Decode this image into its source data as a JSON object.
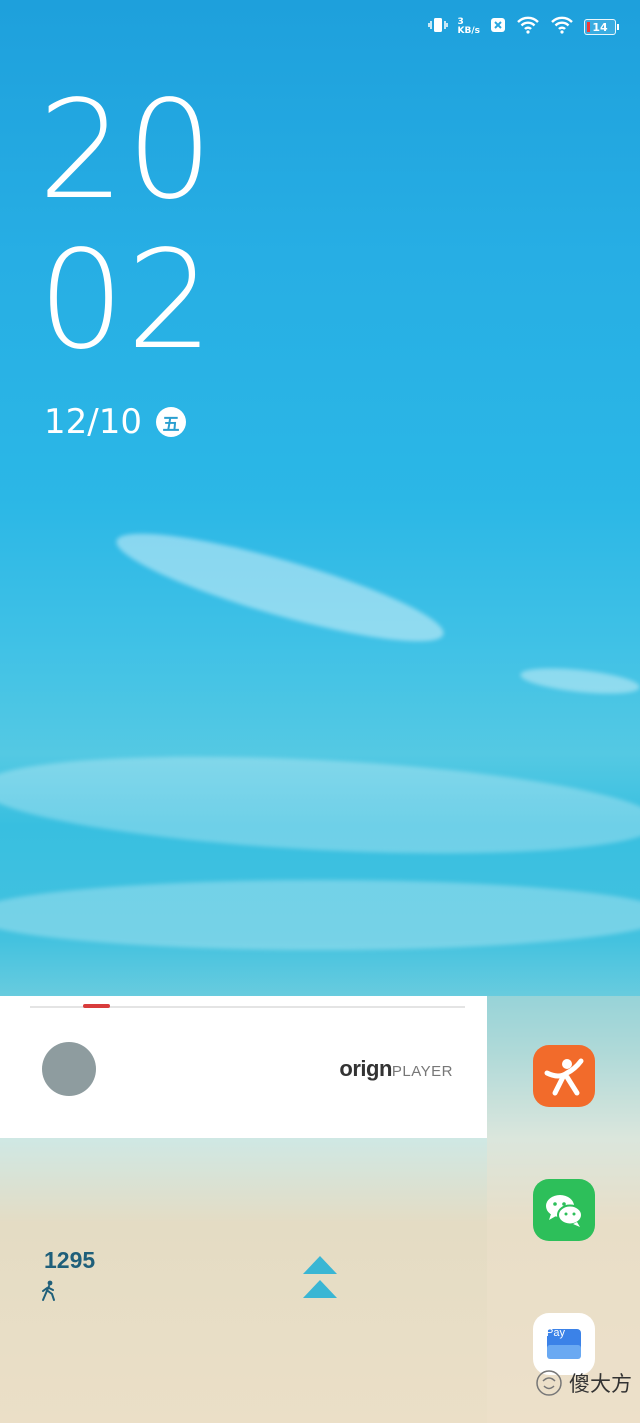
{
  "status_bar": {
    "net_speed_value": "3",
    "net_speed_unit": "KB/s",
    "battery_level": "14",
    "icons": [
      "vibrate-icon",
      "net-speed",
      "nfc-icon",
      "wifi-icon",
      "wifi-icon",
      "battery-icon"
    ]
  },
  "clock": {
    "hours": "20",
    "minutes": "02"
  },
  "date": {
    "text": "12/10",
    "weekday": "五"
  },
  "music_player": {
    "brand_part1": "orig",
    "brand_part2": "n",
    "brand_player": "PLAYER",
    "progress": 0.14,
    "accent_color": "#d83c3c"
  },
  "steps": {
    "count": "1295",
    "icon": "walking-icon"
  },
  "swipe_hint_icon": "chevrons-up-icon",
  "dock_apps": [
    {
      "name": "tourism-app",
      "color": "#f26b2b"
    },
    {
      "name": "wechat",
      "color": "#2dbf5a"
    },
    {
      "name": "wallet-pay",
      "label": "Pay",
      "color": "#ffffff"
    }
  ],
  "watermark": {
    "text": "傻大方"
  }
}
